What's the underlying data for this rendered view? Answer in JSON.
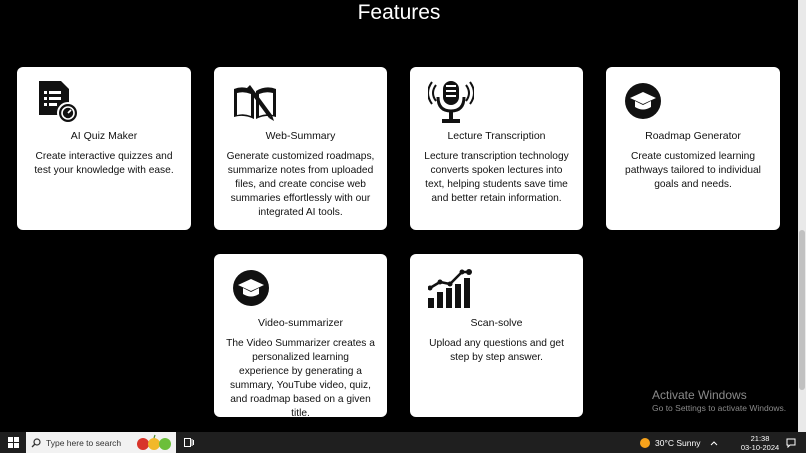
{
  "page": {
    "title": "Features"
  },
  "features": [
    {
      "title": "AI Quiz Maker",
      "desc": "Create interactive quizzes and test your knowledge with ease.",
      "icon": "quiz-document-icon"
    },
    {
      "title": "Web-Summary",
      "desc": "Generate customized roadmaps, summarize notes from uploaded files, and create concise web summaries effortlessly with our integrated AI tools.",
      "icon": "book-pencil-icon"
    },
    {
      "title": "Lecture Transcription",
      "desc": "Lecture transcription technology converts spoken lectures into text, helping students save time and better retain information.",
      "icon": "microphone-icon"
    },
    {
      "title": "Roadmap Generator",
      "desc": "Create customized learning pathways tailored to individual goals and needs.",
      "icon": "graduation-cap-icon"
    },
    {
      "title": "Video-summarizer",
      "desc": "The Video Summarizer creates a personalized learning experience by generating a summary, YouTube video, quiz, and roadmap based on a given title.",
      "icon": "graduation-cap-icon"
    },
    {
      "title": "Scan-solve",
      "desc": "Upload any questions and get step by step answer.",
      "icon": "bar-chart-icon"
    }
  ],
  "watermark": {
    "line1": "Activate Windows",
    "line2": "Go to Settings to activate Windows."
  },
  "taskbar": {
    "search_placeholder": "Type here to search",
    "weather": "30°C  Sunny",
    "time": "21:38",
    "date": "03-10-2024"
  }
}
